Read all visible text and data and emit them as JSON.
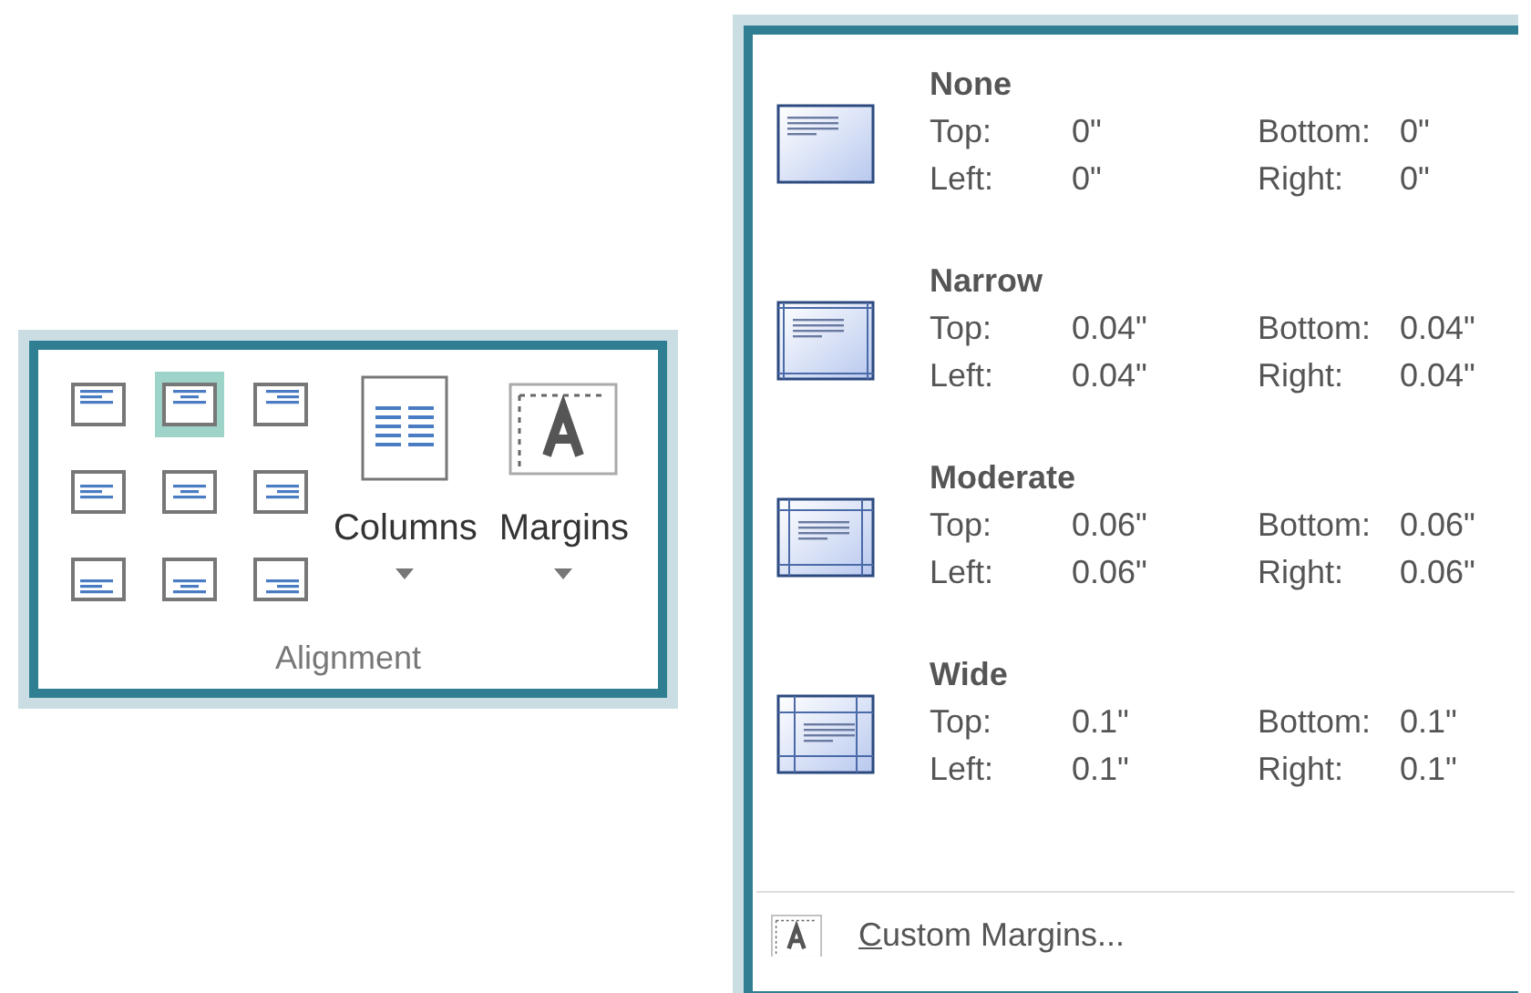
{
  "ribbon_group": {
    "title": "Alignment",
    "alignment_buttons": [
      {
        "kind": "top-left",
        "selected": false
      },
      {
        "kind": "top-center",
        "selected": true
      },
      {
        "kind": "top-right",
        "selected": false
      },
      {
        "kind": "middle-left",
        "selected": false
      },
      {
        "kind": "middle-center",
        "selected": false
      },
      {
        "kind": "middle-right",
        "selected": false
      },
      {
        "kind": "bottom-left",
        "selected": false
      },
      {
        "kind": "bottom-center",
        "selected": false
      },
      {
        "kind": "bottom-right",
        "selected": false
      }
    ],
    "large_buttons": [
      {
        "kind": "columns",
        "label": "Columns"
      },
      {
        "kind": "margins",
        "label": "Margins"
      }
    ]
  },
  "margins_menu": {
    "presets": [
      {
        "kind": "none",
        "name": "None",
        "fields": [
          {
            "label": "Top:",
            "value": "0\""
          },
          {
            "label": "Bottom:",
            "value": "0\""
          },
          {
            "label": "Left:",
            "value": "0\""
          },
          {
            "label": "Right:",
            "value": "0\""
          }
        ]
      },
      {
        "kind": "narrow",
        "name": "Narrow",
        "fields": [
          {
            "label": "Top:",
            "value": "0.04\""
          },
          {
            "label": "Bottom:",
            "value": "0.04\""
          },
          {
            "label": "Left:",
            "value": "0.04\""
          },
          {
            "label": "Right:",
            "value": "0.04\""
          }
        ]
      },
      {
        "kind": "moderate",
        "name": "Moderate",
        "fields": [
          {
            "label": "Top:",
            "value": "0.06\""
          },
          {
            "label": "Bottom:",
            "value": "0.06\""
          },
          {
            "label": "Left:",
            "value": "0.06\""
          },
          {
            "label": "Right:",
            "value": "0.06\""
          }
        ]
      },
      {
        "kind": "wide",
        "name": "Wide",
        "fields": [
          {
            "label": "Top:",
            "value": "0.1\""
          },
          {
            "label": "Bottom:",
            "value": "0.1\""
          },
          {
            "label": "Left:",
            "value": "0.1\""
          },
          {
            "label": "Right:",
            "value": "0.1\""
          }
        ]
      }
    ],
    "custom": {
      "accelerator": "C",
      "rest": "ustom Margins..."
    }
  }
}
